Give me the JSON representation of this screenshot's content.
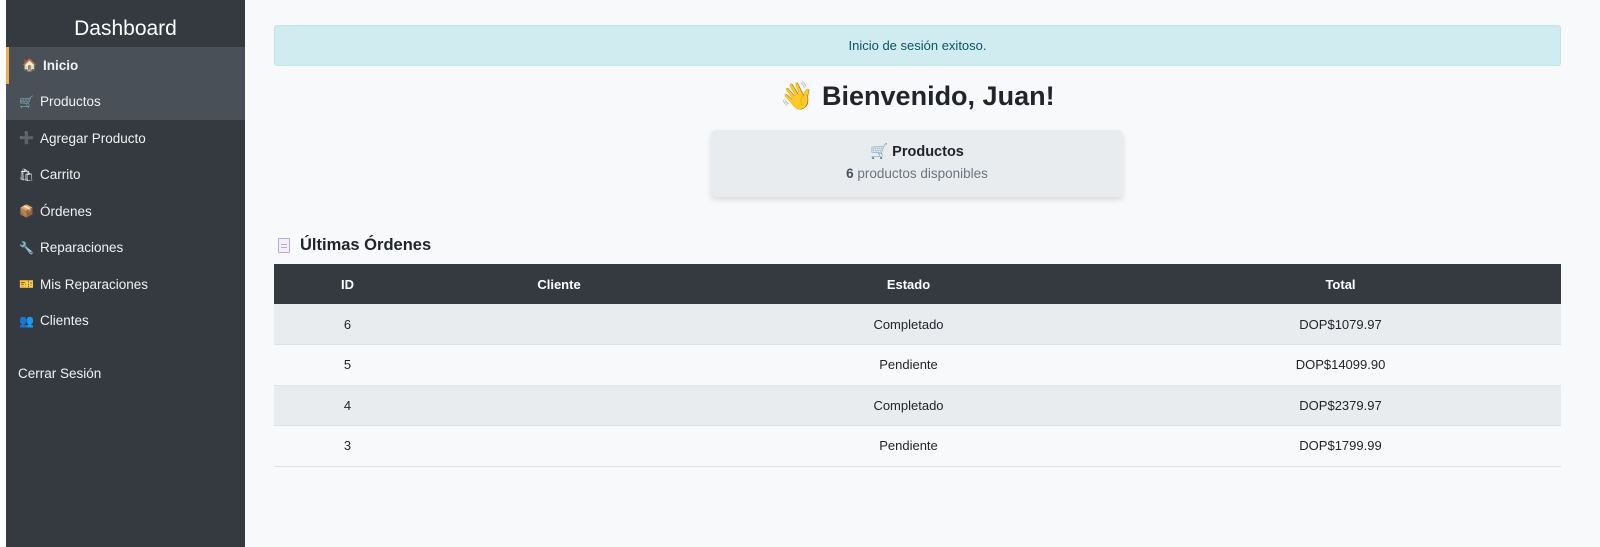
{
  "sidebar": {
    "title": "Dashboard",
    "items": [
      {
        "label": "Inicio",
        "icon": "🏠"
      },
      {
        "label": "Productos",
        "icon": "🛒"
      },
      {
        "label": "Agregar Producto",
        "icon": "➕"
      },
      {
        "label": "Carrito",
        "icon": "🛍"
      },
      {
        "label": "Órdenes",
        "icon": "📦"
      },
      {
        "label": "Reparaciones",
        "icon": "🔧"
      },
      {
        "label": "Mis Reparaciones",
        "icon": "🎫"
      },
      {
        "label": "Clientes",
        "icon": "👥"
      }
    ],
    "logout_label": "Cerrar Sesión"
  },
  "alert": {
    "text": "Inicio de sesión exitoso."
  },
  "welcome": {
    "wave": "👋",
    "text": "Bienvenido, Juan!"
  },
  "card": {
    "icon": "🛒",
    "title": "Productos",
    "count": "6",
    "subtitle": "productos disponibles"
  },
  "orders": {
    "title": "Últimas Órdenes",
    "headers": [
      "ID",
      "Cliente",
      "Estado",
      "Total"
    ],
    "rows": [
      {
        "id": "6",
        "cliente": "",
        "estado": "Completado",
        "total": "DOP$1079.97"
      },
      {
        "id": "5",
        "cliente": "",
        "estado": "Pendiente",
        "total": "DOP$14099.90"
      },
      {
        "id": "4",
        "cliente": "",
        "estado": "Completado",
        "total": "DOP$2379.97"
      },
      {
        "id": "3",
        "cliente": "",
        "estado": "Pendiente",
        "total": "DOP$1799.99"
      }
    ]
  },
  "colors": {
    "sidebar_bg": "#343a40",
    "active_accent": "#f0ad4e",
    "alert_bg": "#d1ecf1",
    "alert_text": "#0c5460"
  }
}
